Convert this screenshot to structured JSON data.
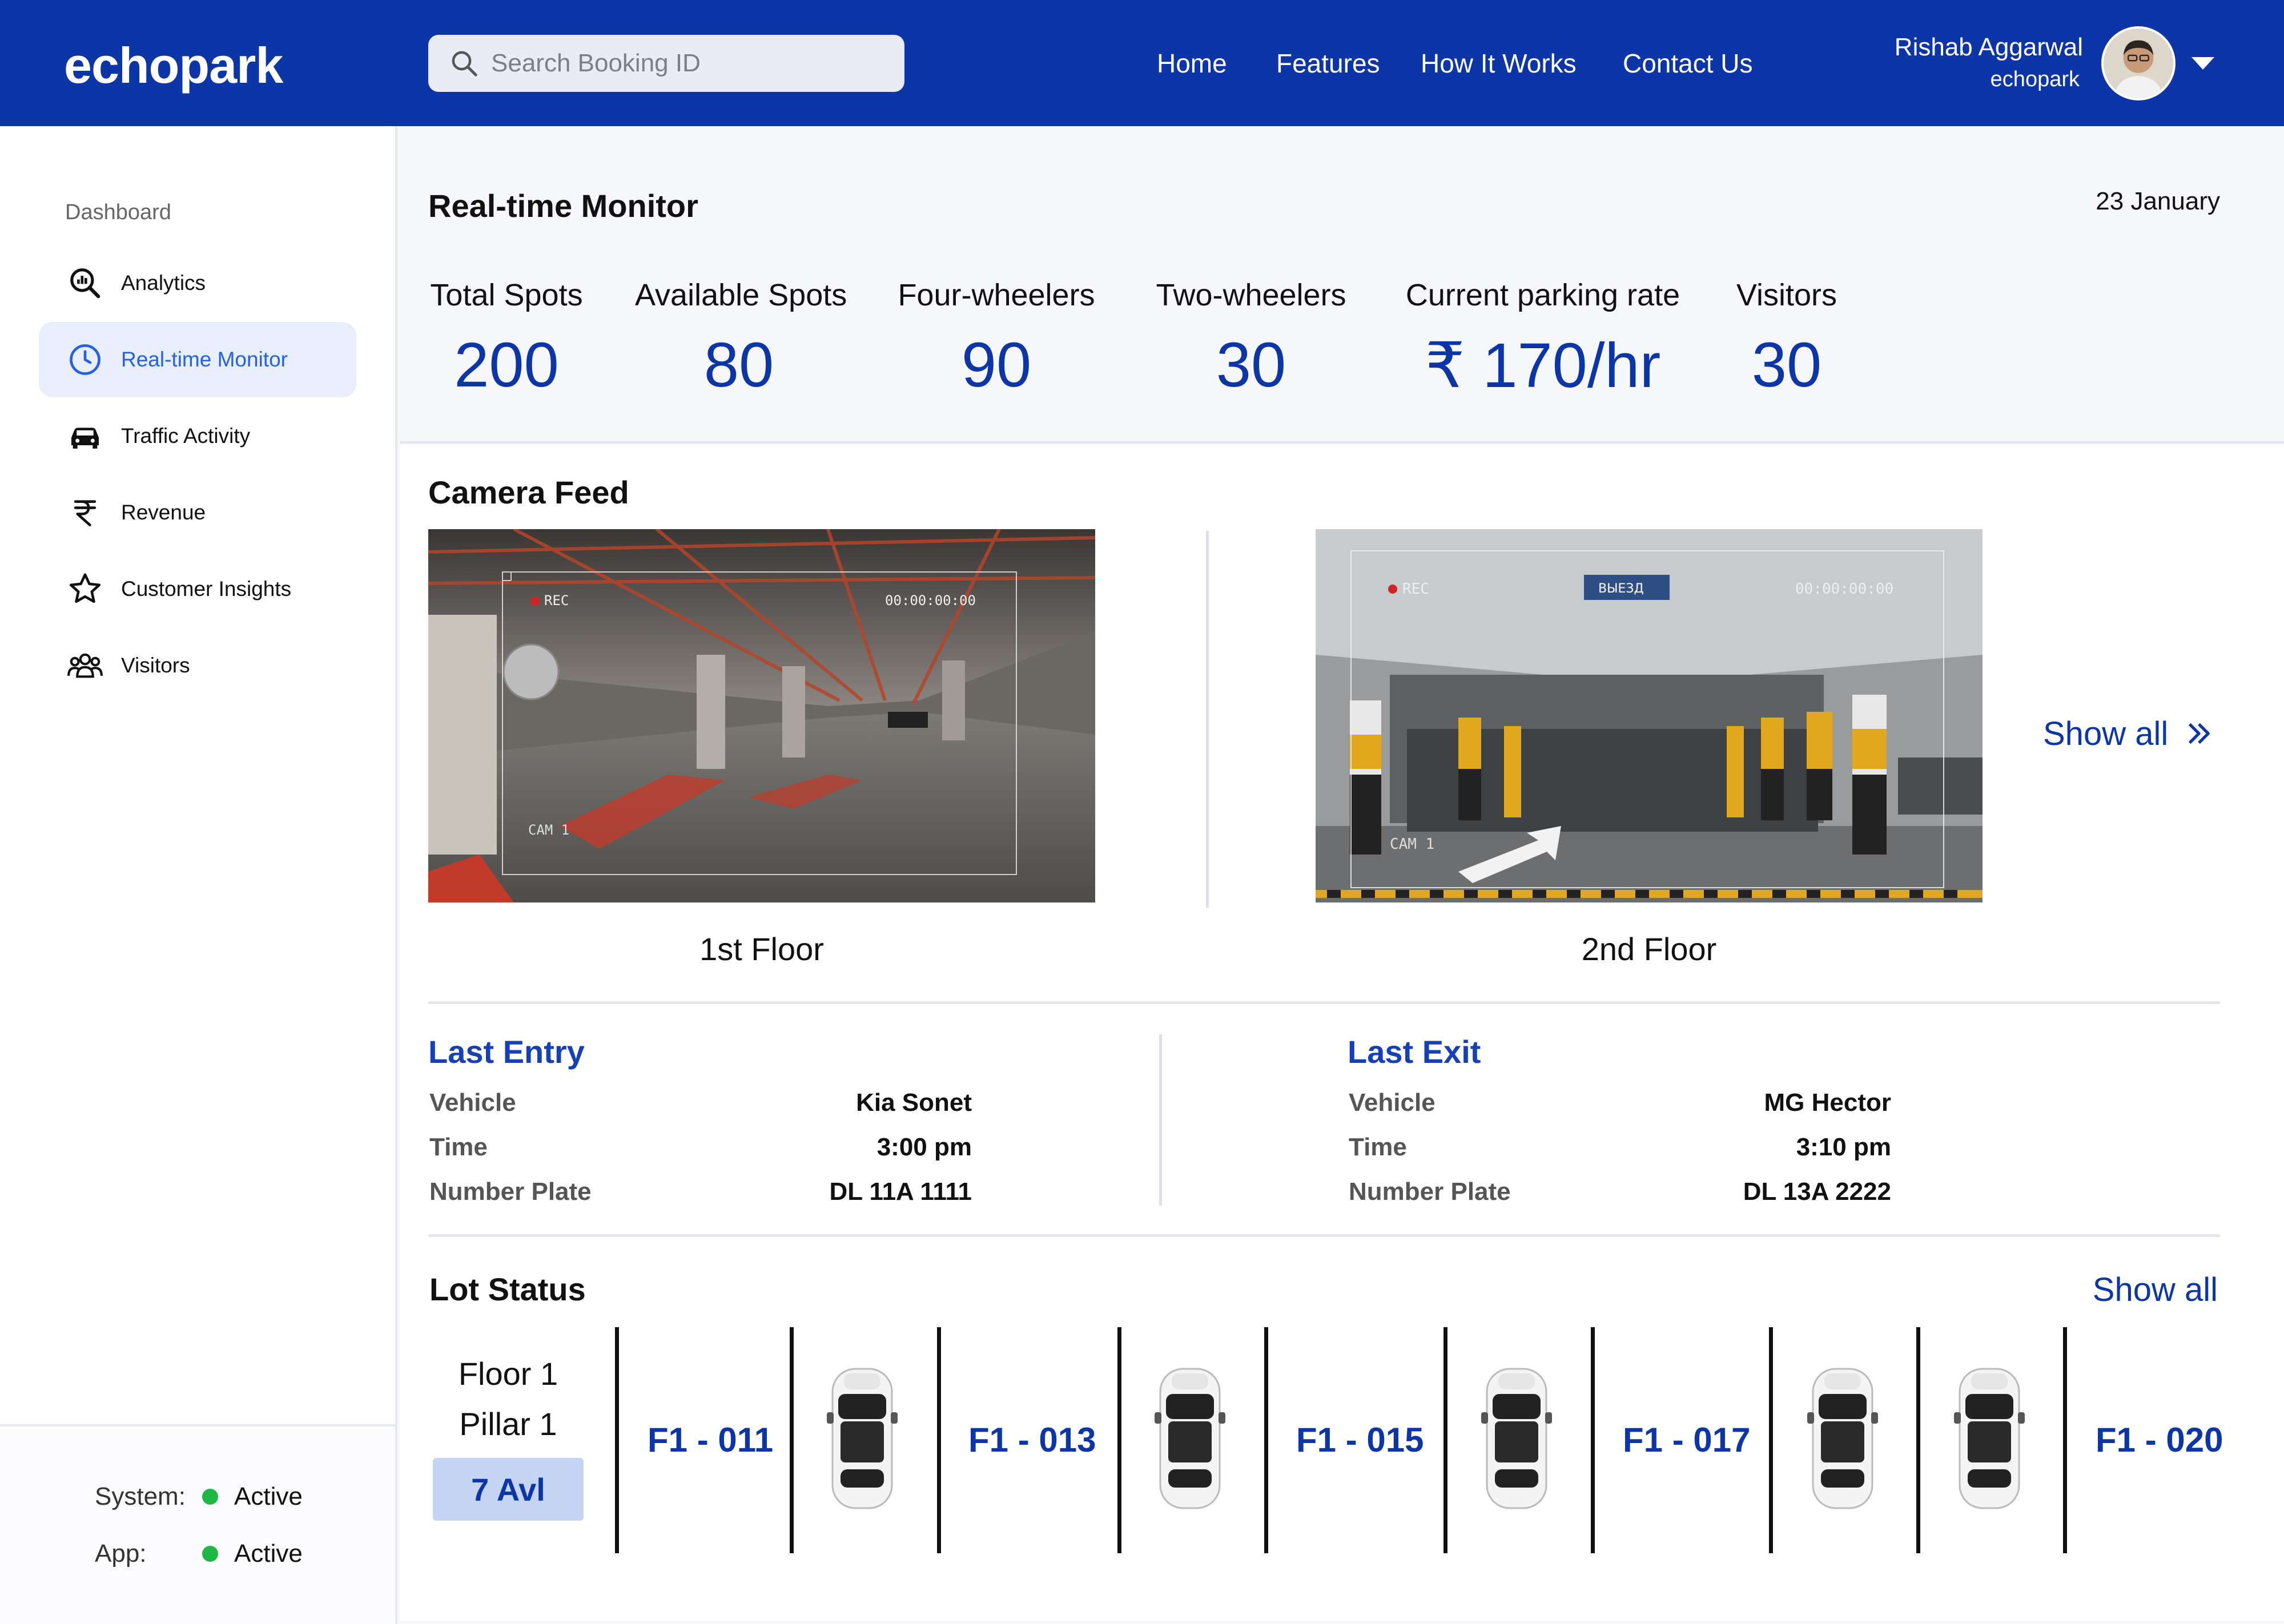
{
  "header": {
    "logo": "echopark",
    "search_placeholder": "Search Booking ID",
    "nav": [
      "Home",
      "Features",
      "How It Works",
      "Contact Us"
    ],
    "user_name": "Rishab Aggarwal",
    "user_org": "echopark"
  },
  "sidebar": {
    "section_title": "Dashboard",
    "items": [
      {
        "label": "Analytics",
        "icon": "analytics-icon"
      },
      {
        "label": "Real-time Monitor",
        "icon": "clock-icon",
        "active": true
      },
      {
        "label": "Traffic Activity",
        "icon": "car-icon"
      },
      {
        "label": "Revenue",
        "icon": "rupee-icon"
      },
      {
        "label": "Customer Insights",
        "icon": "star-icon"
      },
      {
        "label": "Visitors",
        "icon": "users-icon"
      }
    ],
    "status": [
      {
        "key": "System:",
        "value": "Active",
        "color": "#1db843"
      },
      {
        "key": "App:",
        "value": "Active",
        "color": "#1db843"
      }
    ]
  },
  "monitor": {
    "title": "Real-time Monitor",
    "date": "23 January",
    "metrics": [
      {
        "label": "Total Spots",
        "value": "200"
      },
      {
        "label": "Available Spots",
        "value": "80"
      },
      {
        "label": "Four-wheelers",
        "value": "90"
      },
      {
        "label": "Two-wheelers",
        "value": "30"
      },
      {
        "label": "Current parking rate",
        "value": "₹ 170/hr"
      },
      {
        "label": "Visitors",
        "value": "30"
      }
    ]
  },
  "camera": {
    "title": "Camera Feed",
    "feeds": [
      {
        "caption": "1st Floor",
        "rec": "REC",
        "timecode": "00:00:00:00",
        "cam": "CAM 1"
      },
      {
        "caption": "2nd Floor",
        "rec": "REC",
        "timecode": "00:00:00:00",
        "cam": "CAM 1",
        "sign": "ВЫЕЗД"
      }
    ],
    "show_all": "Show all"
  },
  "events": {
    "entry": {
      "title": "Last Entry",
      "rows": [
        {
          "key": "Vehicle",
          "value": "Kia Sonet"
        },
        {
          "key": "Time",
          "value": "3:00 pm"
        },
        {
          "key": "Number Plate",
          "value": "DL 11A 1111"
        }
      ]
    },
    "exit": {
      "title": "Last Exit",
      "rows": [
        {
          "key": "Vehicle",
          "value": "MG Hector"
        },
        {
          "key": "Time",
          "value": "3:10 pm"
        },
        {
          "key": "Number Plate",
          "value": "DL 13A 2222"
        }
      ]
    }
  },
  "lot": {
    "title": "Lot Status",
    "show_all": "Show all",
    "floor": "Floor 1",
    "pillar": "Pillar 1",
    "available": "7 Avl",
    "spots": [
      {
        "label": "F1 - 011",
        "occupied": false
      },
      {
        "label": "",
        "occupied": true
      },
      {
        "label": "F1 - 013",
        "occupied": false
      },
      {
        "label": "",
        "occupied": true
      },
      {
        "label": "F1 - 015",
        "occupied": false
      },
      {
        "label": "",
        "occupied": true
      },
      {
        "label": "F1 - 017",
        "occupied": false
      },
      {
        "label": "",
        "occupied": true
      },
      {
        "label": "",
        "occupied": true
      },
      {
        "label": "F1 - 020",
        "occupied": false
      }
    ]
  },
  "colors": {
    "brand": "#0c35a8",
    "active_nav_bg": "#e8eefc",
    "status_green": "#1db843"
  }
}
